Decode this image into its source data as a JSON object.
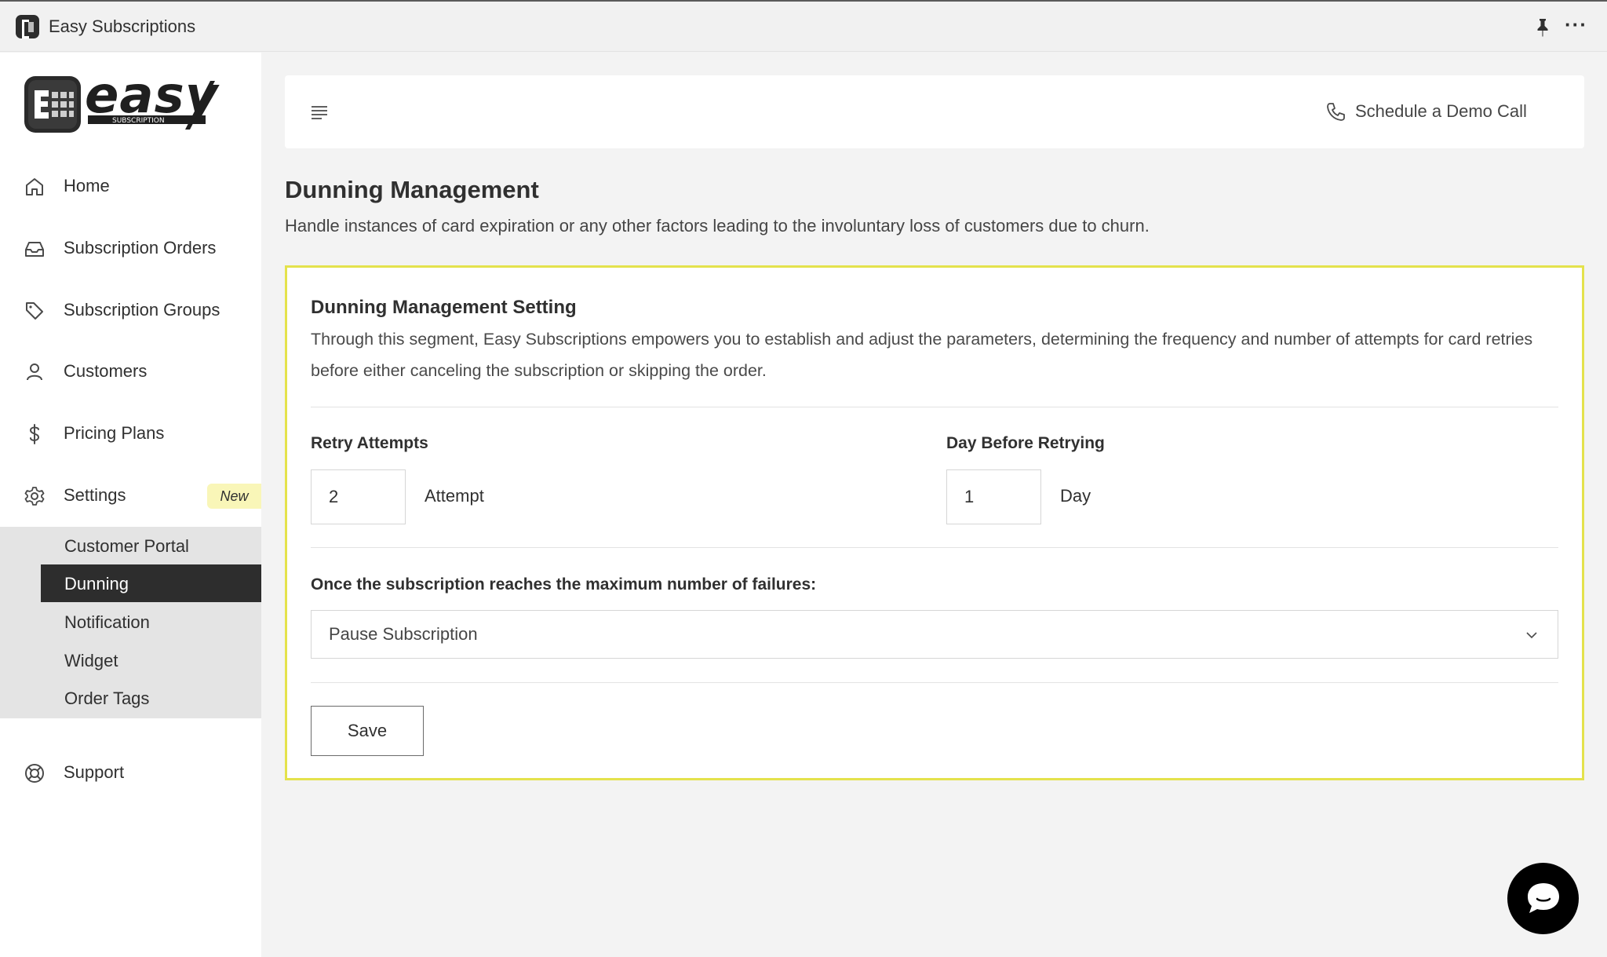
{
  "window": {
    "title": "Easy Subscriptions"
  },
  "logo": {
    "word": "easy",
    "tag": "SUBSCRIPTION"
  },
  "sidebar": {
    "items": [
      {
        "label": "Home",
        "icon": "home-icon"
      },
      {
        "label": "Subscription Orders",
        "icon": "inbox-icon"
      },
      {
        "label": "Subscription Groups",
        "icon": "tag-icon"
      },
      {
        "label": "Customers",
        "icon": "user-icon"
      },
      {
        "label": "Pricing Plans",
        "icon": "dollar-icon"
      },
      {
        "label": "Settings",
        "icon": "gear-icon",
        "badge": "New"
      }
    ],
    "settings_sub": [
      {
        "label": "Customer Portal"
      },
      {
        "label": "Dunning",
        "active": true
      },
      {
        "label": "Notification"
      },
      {
        "label": "Widget"
      },
      {
        "label": "Order Tags"
      }
    ],
    "support": {
      "label": "Support",
      "icon": "lifebuoy-icon"
    }
  },
  "header": {
    "demo_label": "Schedule a Demo Call"
  },
  "page": {
    "title": "Dunning Management",
    "subtitle": "Handle instances of card expiration or any other factors leading to the involuntary loss of customers due to churn."
  },
  "card": {
    "title": "Dunning Management Setting",
    "description": "Through this segment, Easy Subscriptions empowers you to establish and adjust the parameters, determining the frequency and number of attempts for card retries before either canceling the subscription or skipping the order.",
    "retry": {
      "label": "Retry Attempts",
      "value": "2",
      "unit": "Attempt"
    },
    "days": {
      "label": "Day Before Retrying",
      "value": "1",
      "unit": "Day"
    },
    "failure": {
      "label": "Once the subscription reaches the maximum number of failures:",
      "selected": "Pause Subscription"
    },
    "save_label": "Save"
  },
  "colors": {
    "accent_border": "#e4e24c",
    "active_nav": "#2d2d2d",
    "badge_bg": "#f9f6b8"
  }
}
